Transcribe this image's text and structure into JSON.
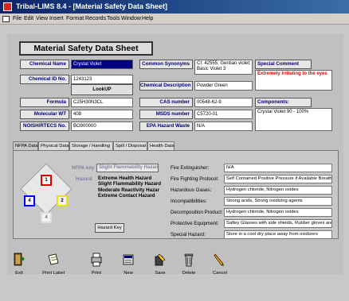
{
  "window": {
    "title": "Tribal-LIMS 8.4 - [Material Safety Data Sheet]"
  },
  "menu": [
    "File",
    "Edit",
    "View",
    "Insert",
    "Format",
    "Records",
    "Tools",
    "Window",
    "Help"
  ],
  "form": {
    "heading": "Material Safety Data Sheet",
    "chemical_name": {
      "label": "Chemical Name",
      "value": "Crystal Violet"
    },
    "chemical_id": {
      "label": "Chemical ID No.",
      "value": "1243123"
    },
    "lookup_button": "LookUP",
    "formula": {
      "label": "Formula",
      "value": "C25H30N3CL"
    },
    "molecular_wt": {
      "label": "Molecular WT",
      "value": "408"
    },
    "niosh_rtecs": {
      "label": "NOISH/RTECS No.",
      "value": "BO900000"
    },
    "common_synonyms": {
      "label": "Common Synonyms",
      "value": "CI: 42555; Gentian violet; Basic Violet 3"
    },
    "chemical_description": {
      "label": "Chemical Description",
      "value": "Powder Green"
    },
    "cas_number": {
      "label": "CAS number",
      "value": "00548-62-9"
    },
    "msds_number": {
      "label": "MSDS number",
      "value": "C5720-01"
    },
    "epa_hazard_waste": {
      "label": "EPA Hazard Waste",
      "value": "N/A"
    },
    "special_comment": {
      "label": "Special Comment",
      "value": "Extremely Irritating to the eyes"
    },
    "components": {
      "label": "Components:",
      "value": "Crystal Violet 90 - 100%"
    }
  },
  "tabs": [
    "NFPA Data",
    "Physical Data",
    "Storage / Handling",
    "Spill / Disposal",
    "Health Data"
  ],
  "active_tab": "NFPA Data",
  "nfpa": {
    "key_label": "NFPA key",
    "key_value": "Slight Flammability Hazard",
    "hazard_label": "Hazard",
    "hazards": [
      "Extreme  Health Hazard",
      "Slight  Flammability Hazard",
      "Moderate  Reactivity Hazar",
      "Extreme  Contact Hazard"
    ],
    "diamond": {
      "top": "1",
      "left": "4",
      "right": "2",
      "bottom": "4"
    },
    "hazard_key_button": "Hazard Key",
    "rows": [
      {
        "label": "Fire Extinguisher:",
        "value": "N/A"
      },
      {
        "label": "Fire Fighting Protocol:",
        "value": "Self Contained Positive Pressure if Available Breath"
      },
      {
        "label": "Hazardous Gases:",
        "value": "Hydrogen chloride, Nitrogen oxides"
      },
      {
        "label": "Incompatibilities:",
        "value": "Strong acids, Strong oxidizing agents"
      },
      {
        "label": "Decomposition Product:",
        "value": "Hydrogen chloride, Nitrogen oxides"
      },
      {
        "label": "Protective Equipment:",
        "value": "Saftey Glasses with side shields, Rubber gloves are r"
      },
      {
        "label": "Special Hazard:",
        "value": "Store in a cool dry place away from oxidizers"
      }
    ]
  },
  "toolbar": [
    {
      "label": "Exit",
      "icon": "exit-door-icon"
    },
    {
      "label": "Print Label",
      "icon": "label-icon"
    },
    {
      "label": "Print",
      "icon": "printer-icon"
    },
    {
      "label": "New",
      "icon": "new-record-icon"
    },
    {
      "label": "Save",
      "icon": "save-icon"
    },
    {
      "label": "Delete",
      "icon": "trash-icon"
    },
    {
      "label": "Cancel",
      "icon": "cancel-pencil-icon"
    }
  ],
  "colors": {
    "title_bar": "#0a246a",
    "comment_text": "#e00000",
    "label_text": "#00007a",
    "nfpa_red": "#e00000",
    "nfpa_blue": "#0000ff",
    "nfpa_yellow": "#e6e600"
  }
}
